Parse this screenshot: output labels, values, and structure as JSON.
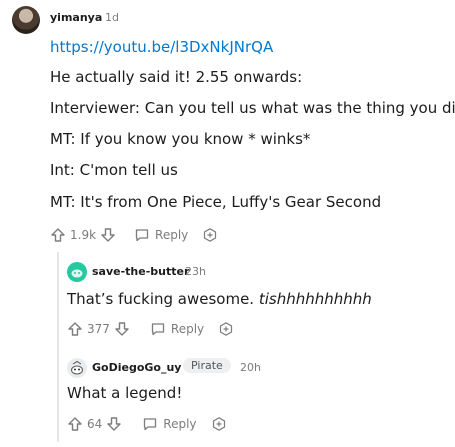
{
  "comment": {
    "username": "yimanya",
    "time": "1d",
    "link": "https://youtu.be/l3DxNkJNrQA",
    "lines": [
      "He actually said it! 2.55 onwards:",
      "Interviewer: Can you tell us what was the thing you did",
      "MT: If you know you know * winks*",
      "Int: C'mon tell us",
      "MT: It's from One Piece, Luffy's Gear Second"
    ],
    "votes": "1.9k",
    "reply_label": "Reply"
  },
  "replies": [
    {
      "username": "save-the-butter",
      "time": "23h",
      "text_main": "That’s fucking awesome.",
      "text_italic": "tishhhhhhhhhh",
      "votes": "377",
      "reply_label": "Reply"
    },
    {
      "username": "GoDiegoGo_uy",
      "flair": "Pirate",
      "time": "20h",
      "text_main": "What a legend!",
      "votes": "64",
      "reply_label": "Reply"
    }
  ],
  "colors": {
    "link": "#0079d3",
    "muted": "#7c7c7c",
    "text": "#1c1c1c",
    "reply1_avatar": "#23c9a0"
  },
  "icons": [
    "upvote-icon",
    "downvote-icon",
    "reply-bubble-icon",
    "award-icon"
  ]
}
